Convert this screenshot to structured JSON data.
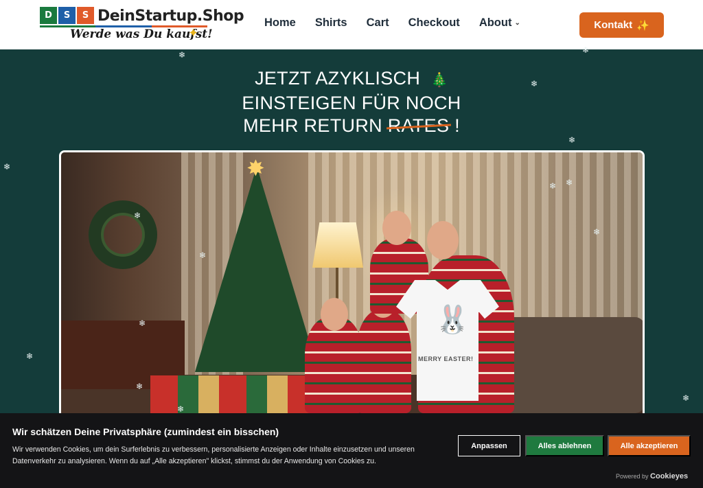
{
  "header": {
    "logo": {
      "letters": [
        "D",
        "S",
        "S"
      ],
      "name": "DeinStartup.Shop",
      "tagline": "Werde was Du kaufst!",
      "sparkle_icon": "sparkle-icon",
      "colors": {
        "green": "#1a7a3e",
        "blue": "#1e5fa8",
        "orange": "#e05a2a"
      }
    },
    "nav": [
      {
        "label": "Home"
      },
      {
        "label": "Shirts"
      },
      {
        "label": "Cart"
      },
      {
        "label": "Checkout"
      },
      {
        "label": "About",
        "has_dropdown": true,
        "icon": "chevron-down-icon"
      }
    ],
    "cta": {
      "label": "Kontakt",
      "icon": "sparkles-icon",
      "color": "#d9641e"
    }
  },
  "hero": {
    "line1": "JETZT AZYKLISCH",
    "line1_icon": "christmas-tree-icon",
    "line2": "EINSTEIGEN FÜR NOCH",
    "line3_prefix": "MEHR RETURN",
    "line3_struck": "RATES",
    "line3_suffix": "!",
    "background": "#143c3a",
    "accent": "#d9641e"
  },
  "photo": {
    "shirt_text": "MERRY EASTER!",
    "shirt_icon": "bunny-icon"
  },
  "cookie_banner": {
    "title": "Wir schätzen Deine Privatsphäre (zumindest ein bisschen)",
    "text": "Wir verwenden Cookies, um dein Surferlebnis zu verbessern, personalisierte Anzeigen oder Inhalte einzusetzen und unseren Datenverkehr zu analysieren. Wenn du auf „Alle akzeptieren\" klickst, stimmst du der Anwendung von Cookies zu.",
    "buttons": {
      "customize": "Anpassen",
      "reject": "Alles ablehnen",
      "accept": "Alle akzeptieren"
    },
    "powered_by": "Powered by",
    "powered_brand": "Cookieyes",
    "colors": {
      "background": "#141416",
      "reject": "#1f7a3f",
      "accept": "#d9641e"
    }
  }
}
